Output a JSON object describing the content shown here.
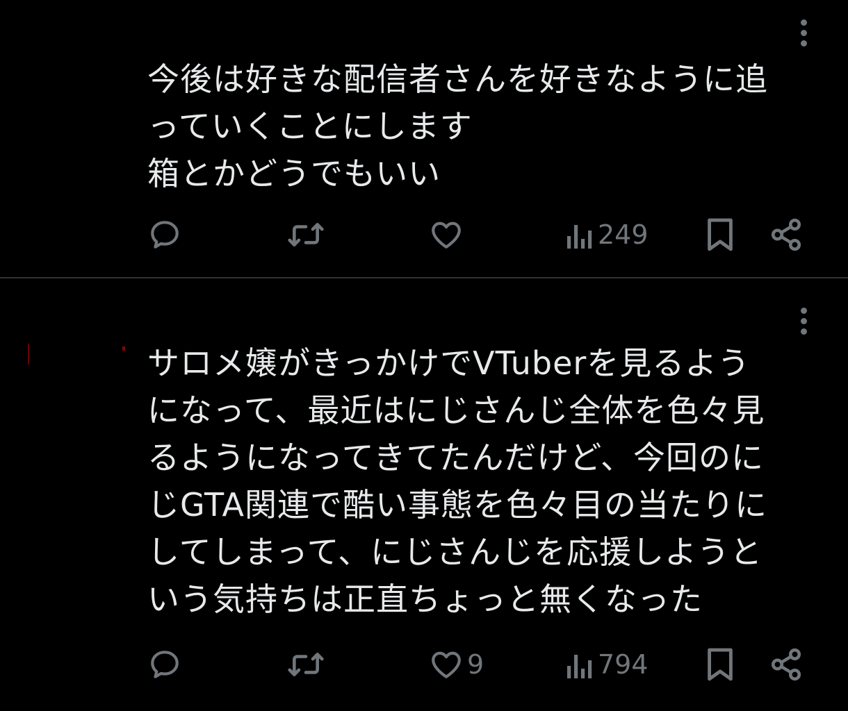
{
  "posts": [
    {
      "lines": [
        "今後は好きな配信者さんを好きなように追",
        "っていくことにします",
        "箱とかどうでもいい"
      ],
      "actions": {
        "reply_count": "",
        "retweet_count": "",
        "like_count": "",
        "views_count": "249"
      }
    },
    {
      "lines": [
        "サロメ嬢がきっかけでVTuberを見るよう",
        "になって、最近はにじさんじ全体を色々見",
        "るようになってきてたんだけど、今回のに",
        "じGTA関連で酷い事態を色々目の当たりに",
        "してしまって、にじさんじを応援しようと",
        "いう気持ちは正直ちょっと無くなった"
      ],
      "actions": {
        "reply_count": "",
        "retweet_count": "",
        "like_count": "9",
        "views_count": "794"
      }
    }
  ],
  "icons": {
    "reply": "speech-bubble-icon",
    "retweet": "retweet-arrows-icon",
    "like": "heart-icon",
    "views": "bar-chart-icon",
    "bookmark": "bookmark-icon",
    "share": "share-icon",
    "more": "vertical-ellipsis-icon"
  },
  "colors": {
    "background": "#000000",
    "text": "#e7e9ea",
    "icon": "#71767b",
    "divider": "#2f3336"
  }
}
